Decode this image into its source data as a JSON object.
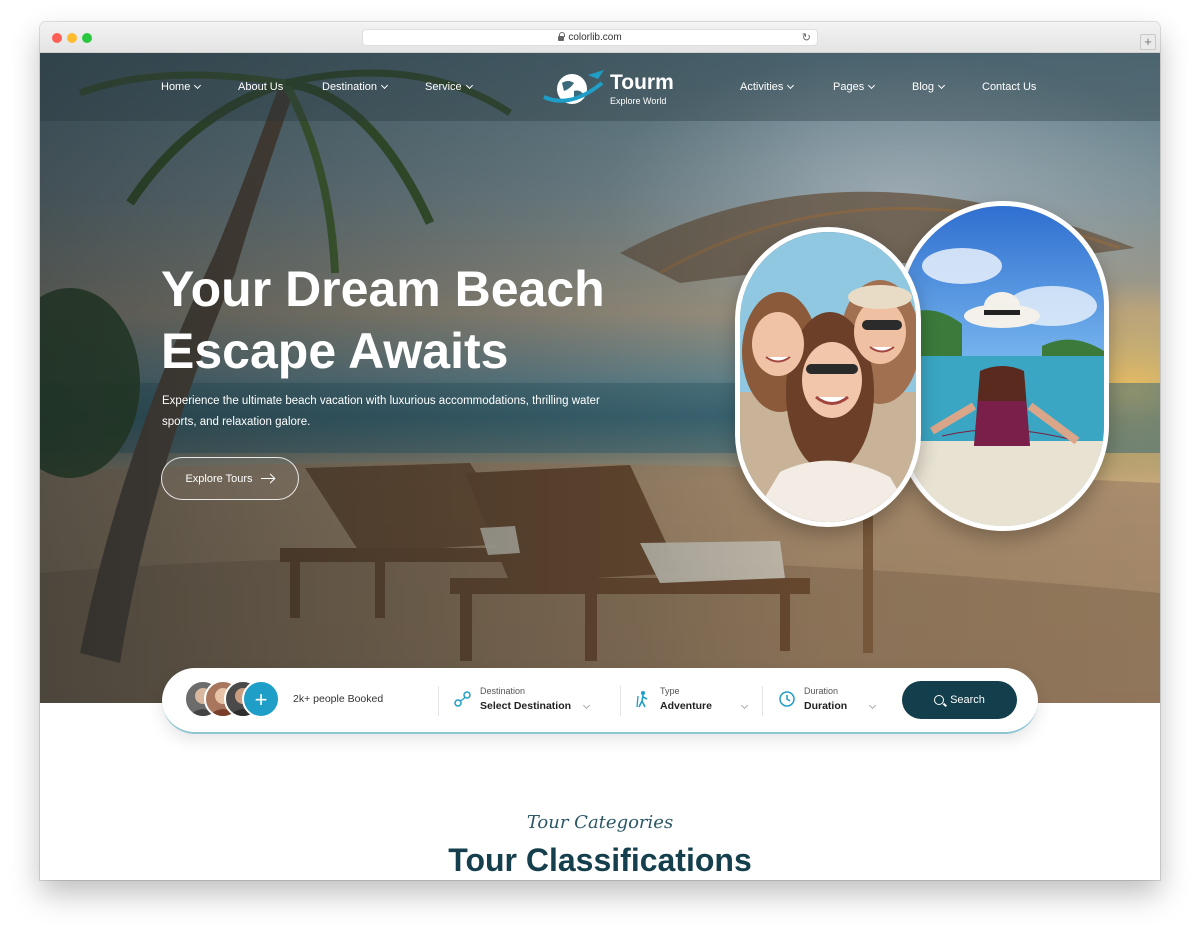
{
  "browser": {
    "url": "colorlib.com",
    "new_tab_symbol": "+"
  },
  "brand": {
    "name": "Tourm",
    "tagline": "Explore World"
  },
  "nav": {
    "left": [
      {
        "label": "Home",
        "has_dropdown": true
      },
      {
        "label": "About Us",
        "has_dropdown": false
      },
      {
        "label": "Destination",
        "has_dropdown": true
      },
      {
        "label": "Service",
        "has_dropdown": true
      }
    ],
    "right": [
      {
        "label": "Activities",
        "has_dropdown": true
      },
      {
        "label": "Pages",
        "has_dropdown": true
      },
      {
        "label": "Blog",
        "has_dropdown": true
      },
      {
        "label": "Contact Us",
        "has_dropdown": false
      }
    ]
  },
  "hero": {
    "title_line1": "Your Dream Beach",
    "title_line2": "Escape Awaits",
    "description": "Experience the ultimate beach vacation with luxurious accommodations, thrilling water sports, and relaxation galore.",
    "cta_label": "Explore Tours"
  },
  "search": {
    "avatar_plus": "+",
    "booked_text": "2k+ people Booked",
    "destination": {
      "label": "Destination",
      "value": "Select Destination"
    },
    "type": {
      "label": "Type",
      "value": "Adventure"
    },
    "duration": {
      "label": "Duration",
      "value": "Duration"
    },
    "button_label": "Search"
  },
  "section": {
    "subtitle": "Tour Categories",
    "title": "Tour Classifications"
  },
  "colors": {
    "accent": "#1f9ec7",
    "dark_teal": "#123f4b",
    "heading": "#153f4d"
  }
}
